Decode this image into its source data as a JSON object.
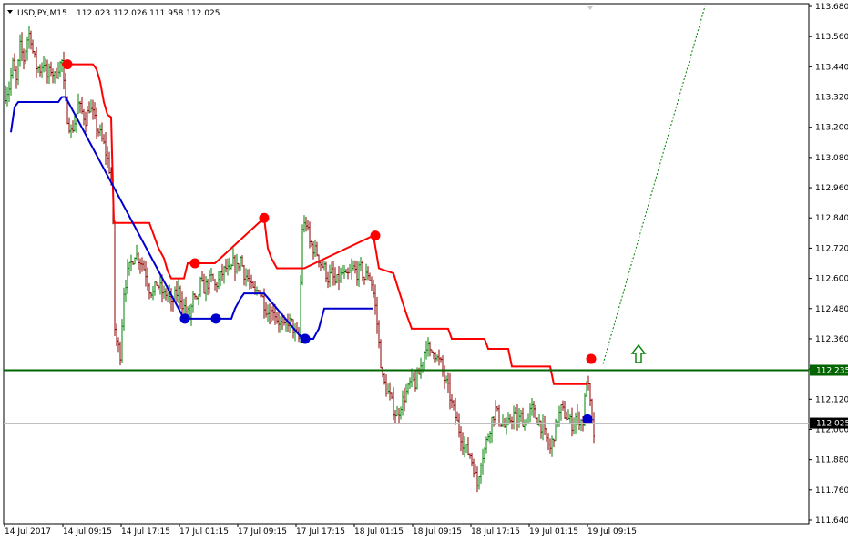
{
  "header": {
    "symbol": "USDJPY,M15",
    "ohlc": "112.023 112.026 111.958 112.025"
  },
  "chart_data": {
    "type": "candlestick",
    "title": "USDJPY,M15",
    "ylim": [
      111.64,
      113.68
    ],
    "y_ticks": [
      "113.680",
      "113.560",
      "113.440",
      "113.320",
      "113.200",
      "113.080",
      "112.960",
      "112.840",
      "112.720",
      "112.600",
      "112.480",
      "112.360",
      "112.240",
      "112.120",
      "112.000",
      "111.880",
      "111.760",
      "111.640"
    ],
    "x_ticks": [
      "14 Jul 2017",
      "14 Jul 09:15",
      "14 Jul 17:15",
      "17 Jul 01:15",
      "17 Jul 09:15",
      "17 Jul 17:15",
      "18 Jul 01:15",
      "18 Jul 09:15",
      "18 Jul 17:15",
      "19 Jul 01:15",
      "19 Jul 09:15"
    ],
    "grid": false,
    "price_path": [
      [
        0,
        113.33
      ],
      [
        4,
        113.36
      ],
      [
        8,
        113.45
      ],
      [
        12,
        113.38
      ],
      [
        16,
        113.52
      ],
      [
        20,
        113.47
      ],
      [
        24,
        113.55
      ],
      [
        27,
        113.58
      ],
      [
        30,
        113.5
      ],
      [
        34,
        113.44
      ],
      [
        38,
        113.43
      ],
      [
        42,
        113.46
      ],
      [
        46,
        113.4
      ],
      [
        50,
        113.43
      ],
      [
        54,
        113.4
      ],
      [
        58,
        113.44
      ],
      [
        62,
        113.46
      ],
      [
        65,
        113.32
      ],
      [
        68,
        113.24
      ],
      [
        72,
        113.18
      ],
      [
        76,
        113.22
      ],
      [
        80,
        113.29
      ],
      [
        84,
        113.26
      ],
      [
        88,
        113.23
      ],
      [
        92,
        113.28
      ],
      [
        96,
        113.25
      ],
      [
        100,
        113.2
      ],
      [
        104,
        113.17
      ],
      [
        108,
        113.13
      ],
      [
        112,
        113.07
      ],
      [
        116,
        113.0
      ],
      [
        119,
        112.7
      ],
      [
        120,
        112.4
      ],
      [
        122,
        112.35
      ],
      [
        126,
        112.3
      ],
      [
        130,
        112.55
      ],
      [
        134,
        112.62
      ],
      [
        138,
        112.66
      ],
      [
        142,
        112.7
      ],
      [
        146,
        112.68
      ],
      [
        150,
        112.66
      ],
      [
        154,
        112.62
      ],
      [
        158,
        112.56
      ],
      [
        162,
        112.54
      ],
      [
        166,
        112.58
      ],
      [
        170,
        112.56
      ],
      [
        174,
        112.53
      ],
      [
        178,
        112.55
      ],
      [
        182,
        112.49
      ],
      [
        186,
        112.53
      ],
      [
        190,
        112.55
      ],
      [
        194,
        112.5
      ],
      [
        198,
        112.47
      ],
      [
        202,
        112.45
      ],
      [
        206,
        112.52
      ],
      [
        210,
        112.5
      ],
      [
        214,
        112.58
      ],
      [
        218,
        112.56
      ],
      [
        222,
        112.58
      ],
      [
        226,
        112.6
      ],
      [
        230,
        112.57
      ],
      [
        234,
        112.59
      ],
      [
        238,
        112.62
      ],
      [
        242,
        112.64
      ],
      [
        246,
        112.62
      ],
      [
        250,
        112.66
      ],
      [
        254,
        112.64
      ],
      [
        258,
        112.68
      ],
      [
        262,
        112.62
      ],
      [
        266,
        112.6
      ],
      [
        270,
        112.56
      ],
      [
        274,
        112.54
      ],
      [
        278,
        112.56
      ],
      [
        282,
        112.52
      ],
      [
        286,
        112.48
      ],
      [
        290,
        112.45
      ],
      [
        294,
        112.48
      ],
      [
        298,
        112.44
      ],
      [
        302,
        112.42
      ],
      [
        306,
        112.4
      ],
      [
        310,
        112.43
      ],
      [
        314,
        112.42
      ],
      [
        318,
        112.38
      ],
      [
        322,
        112.36
      ],
      [
        326,
        112.8
      ],
      [
        330,
        112.82
      ],
      [
        334,
        112.74
      ],
      [
        338,
        112.72
      ],
      [
        342,
        112.7
      ],
      [
        346,
        112.66
      ],
      [
        350,
        112.64
      ],
      [
        354,
        112.6
      ],
      [
        358,
        112.62
      ],
      [
        362,
        112.58
      ],
      [
        366,
        112.6
      ],
      [
        370,
        112.62
      ],
      [
        374,
        112.6
      ],
      [
        378,
        112.62
      ],
      [
        382,
        112.64
      ],
      [
        386,
        112.62
      ],
      [
        390,
        112.64
      ],
      [
        394,
        112.6
      ],
      [
        398,
        112.62
      ],
      [
        402,
        112.58
      ],
      [
        405,
        112.52
      ],
      [
        408,
        112.42
      ],
      [
        411,
        112.3
      ],
      [
        414,
        112.2
      ],
      [
        418,
        112.16
      ],
      [
        422,
        112.13
      ],
      [
        426,
        112.08
      ],
      [
        430,
        112.05
      ],
      [
        434,
        112.1
      ],
      [
        438,
        112.13
      ],
      [
        442,
        112.16
      ],
      [
        446,
        112.2
      ],
      [
        450,
        112.18
      ],
      [
        454,
        112.22
      ],
      [
        458,
        112.28
      ],
      [
        462,
        112.34
      ],
      [
        466,
        112.3
      ],
      [
        470,
        112.32
      ],
      [
        474,
        112.28
      ],
      [
        478,
        112.26
      ],
      [
        482,
        112.2
      ],
      [
        486,
        112.16
      ],
      [
        490,
        112.1
      ],
      [
        494,
        112.05
      ],
      [
        498,
        112.0
      ],
      [
        502,
        111.95
      ],
      [
        506,
        111.92
      ],
      [
        510,
        111.9
      ],
      [
        514,
        111.85
      ],
      [
        518,
        111.78
      ],
      [
        522,
        111.88
      ],
      [
        526,
        111.92
      ],
      [
        530,
        111.98
      ],
      [
        534,
        112.04
      ],
      [
        538,
        112.08
      ],
      [
        542,
        112.04
      ],
      [
        546,
        112.02
      ],
      [
        550,
        112.0
      ],
      [
        554,
        112.04
      ],
      [
        558,
        112.06
      ],
      [
        562,
        112.03
      ],
      [
        566,
        112.05
      ],
      [
        570,
        112.02
      ],
      [
        574,
        112.06
      ],
      [
        578,
        112.08
      ],
      [
        582,
        112.05
      ],
      [
        586,
        112.03
      ],
      [
        590,
        112.0
      ],
      [
        594,
        111.96
      ],
      [
        598,
        111.92
      ],
      [
        602,
        111.98
      ],
      [
        606,
        112.04
      ],
      [
        610,
        112.08
      ],
      [
        614,
        112.06
      ],
      [
        618,
        112.04
      ],
      [
        622,
        112.02
      ],
      [
        626,
        112.05
      ],
      [
        630,
        112.04
      ],
      [
        634,
        112.03
      ],
      [
        638,
        112.2
      ],
      [
        641,
        112.14
      ],
      [
        644,
        112.02
      ],
      [
        646,
        111.98
      ]
    ],
    "trailing_stop_upper": [
      [
        62,
        113.45
      ],
      [
        96,
        113.45
      ],
      [
        100,
        113.43
      ],
      [
        104,
        113.38
      ],
      [
        108,
        113.3
      ],
      [
        112,
        113.25
      ],
      [
        116,
        113.24
      ],
      [
        119,
        112.82
      ],
      [
        158,
        112.82
      ],
      [
        162,
        112.78
      ],
      [
        168,
        112.72
      ],
      [
        174,
        112.68
      ],
      [
        178,
        112.63
      ],
      [
        182,
        112.6
      ],
      [
        196,
        112.6
      ],
      [
        200,
        112.66
      ],
      [
        230,
        112.66
      ],
      [
        284,
        112.84
      ],
      [
        288,
        112.72
      ],
      [
        292,
        112.68
      ],
      [
        298,
        112.64
      ],
      [
        328,
        112.64
      ],
      [
        404,
        112.77
      ],
      [
        410,
        112.64
      ],
      [
        426,
        112.62
      ],
      [
        432,
        112.55
      ],
      [
        440,
        112.46
      ],
      [
        446,
        112.4
      ],
      [
        486,
        112.4
      ],
      [
        490,
        112.36
      ],
      [
        526,
        112.36
      ],
      [
        530,
        112.32
      ],
      [
        552,
        112.32
      ],
      [
        556,
        112.25
      ],
      [
        598,
        112.25
      ],
      [
        602,
        112.18
      ],
      [
        638,
        112.18
      ]
    ],
    "trailing_stop_lower": [
      [
        6,
        113.18
      ],
      [
        10,
        113.28
      ],
      [
        14,
        113.3
      ],
      [
        58,
        113.3
      ],
      [
        62,
        113.32
      ],
      [
        66,
        113.32
      ],
      [
        196,
        112.44
      ],
      [
        206,
        112.44
      ],
      [
        230,
        112.44
      ],
      [
        248,
        112.44
      ],
      [
        252,
        112.48
      ],
      [
        258,
        112.52
      ],
      [
        262,
        112.54
      ],
      [
        284,
        112.54
      ],
      [
        326,
        112.36
      ],
      [
        338,
        112.36
      ],
      [
        344,
        112.4
      ],
      [
        350,
        112.48
      ],
      [
        404,
        112.48
      ]
    ],
    "red_dots": [
      [
        68,
        113.45
      ],
      [
        208,
        112.66
      ],
      [
        284,
        112.84
      ],
      [
        406,
        112.77
      ],
      [
        643,
        112.28
      ]
    ],
    "blue_dots": [
      [
        197,
        112.44
      ],
      [
        231,
        112.44
      ],
      [
        329,
        112.36
      ],
      [
        639,
        112.04
      ]
    ],
    "projection": [
      [
        656,
        112.26
      ],
      [
        768,
        113.68
      ]
    ],
    "horizontal_line": {
      "value": 112.235,
      "label": "112.235",
      "color": "#006400"
    },
    "current_price": {
      "value": 112.025,
      "label": "112.025"
    },
    "colors": {
      "bull": "#008000",
      "bear": "#8b0000",
      "stop_upper": "#ff0000",
      "stop_lower": "#0000cd",
      "projection": "#008000",
      "arrow": "#008000"
    }
  }
}
